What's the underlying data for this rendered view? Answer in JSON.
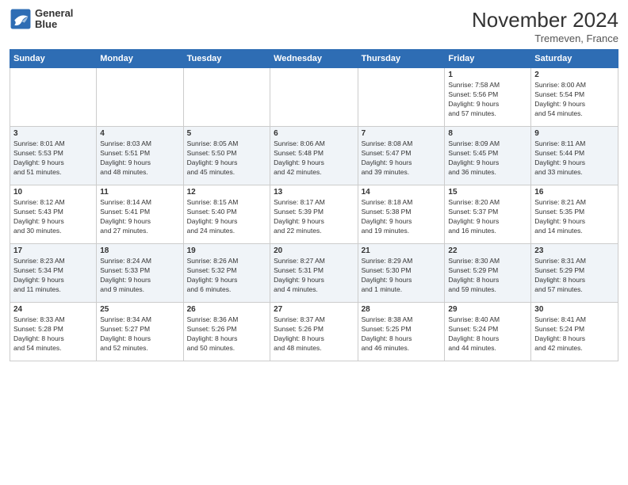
{
  "header": {
    "logo_text_line1": "General",
    "logo_text_line2": "Blue",
    "month_title": "November 2024",
    "location": "Tremeven, France"
  },
  "weekdays": [
    "Sunday",
    "Monday",
    "Tuesday",
    "Wednesday",
    "Thursday",
    "Friday",
    "Saturday"
  ],
  "weeks": [
    {
      "days": [
        {
          "num": "",
          "info": ""
        },
        {
          "num": "",
          "info": ""
        },
        {
          "num": "",
          "info": ""
        },
        {
          "num": "",
          "info": ""
        },
        {
          "num": "",
          "info": ""
        },
        {
          "num": "1",
          "info": "Sunrise: 7:58 AM\nSunset: 5:56 PM\nDaylight: 9 hours\nand 57 minutes."
        },
        {
          "num": "2",
          "info": "Sunrise: 8:00 AM\nSunset: 5:54 PM\nDaylight: 9 hours\nand 54 minutes."
        }
      ]
    },
    {
      "days": [
        {
          "num": "3",
          "info": "Sunrise: 8:01 AM\nSunset: 5:53 PM\nDaylight: 9 hours\nand 51 minutes."
        },
        {
          "num": "4",
          "info": "Sunrise: 8:03 AM\nSunset: 5:51 PM\nDaylight: 9 hours\nand 48 minutes."
        },
        {
          "num": "5",
          "info": "Sunrise: 8:05 AM\nSunset: 5:50 PM\nDaylight: 9 hours\nand 45 minutes."
        },
        {
          "num": "6",
          "info": "Sunrise: 8:06 AM\nSunset: 5:48 PM\nDaylight: 9 hours\nand 42 minutes."
        },
        {
          "num": "7",
          "info": "Sunrise: 8:08 AM\nSunset: 5:47 PM\nDaylight: 9 hours\nand 39 minutes."
        },
        {
          "num": "8",
          "info": "Sunrise: 8:09 AM\nSunset: 5:45 PM\nDaylight: 9 hours\nand 36 minutes."
        },
        {
          "num": "9",
          "info": "Sunrise: 8:11 AM\nSunset: 5:44 PM\nDaylight: 9 hours\nand 33 minutes."
        }
      ]
    },
    {
      "days": [
        {
          "num": "10",
          "info": "Sunrise: 8:12 AM\nSunset: 5:43 PM\nDaylight: 9 hours\nand 30 minutes."
        },
        {
          "num": "11",
          "info": "Sunrise: 8:14 AM\nSunset: 5:41 PM\nDaylight: 9 hours\nand 27 minutes."
        },
        {
          "num": "12",
          "info": "Sunrise: 8:15 AM\nSunset: 5:40 PM\nDaylight: 9 hours\nand 24 minutes."
        },
        {
          "num": "13",
          "info": "Sunrise: 8:17 AM\nSunset: 5:39 PM\nDaylight: 9 hours\nand 22 minutes."
        },
        {
          "num": "14",
          "info": "Sunrise: 8:18 AM\nSunset: 5:38 PM\nDaylight: 9 hours\nand 19 minutes."
        },
        {
          "num": "15",
          "info": "Sunrise: 8:20 AM\nSunset: 5:37 PM\nDaylight: 9 hours\nand 16 minutes."
        },
        {
          "num": "16",
          "info": "Sunrise: 8:21 AM\nSunset: 5:35 PM\nDaylight: 9 hours\nand 14 minutes."
        }
      ]
    },
    {
      "days": [
        {
          "num": "17",
          "info": "Sunrise: 8:23 AM\nSunset: 5:34 PM\nDaylight: 9 hours\nand 11 minutes."
        },
        {
          "num": "18",
          "info": "Sunrise: 8:24 AM\nSunset: 5:33 PM\nDaylight: 9 hours\nand 9 minutes."
        },
        {
          "num": "19",
          "info": "Sunrise: 8:26 AM\nSunset: 5:32 PM\nDaylight: 9 hours\nand 6 minutes."
        },
        {
          "num": "20",
          "info": "Sunrise: 8:27 AM\nSunset: 5:31 PM\nDaylight: 9 hours\nand 4 minutes."
        },
        {
          "num": "21",
          "info": "Sunrise: 8:29 AM\nSunset: 5:30 PM\nDaylight: 9 hours\nand 1 minute."
        },
        {
          "num": "22",
          "info": "Sunrise: 8:30 AM\nSunset: 5:29 PM\nDaylight: 8 hours\nand 59 minutes."
        },
        {
          "num": "23",
          "info": "Sunrise: 8:31 AM\nSunset: 5:29 PM\nDaylight: 8 hours\nand 57 minutes."
        }
      ]
    },
    {
      "days": [
        {
          "num": "24",
          "info": "Sunrise: 8:33 AM\nSunset: 5:28 PM\nDaylight: 8 hours\nand 54 minutes."
        },
        {
          "num": "25",
          "info": "Sunrise: 8:34 AM\nSunset: 5:27 PM\nDaylight: 8 hours\nand 52 minutes."
        },
        {
          "num": "26",
          "info": "Sunrise: 8:36 AM\nSunset: 5:26 PM\nDaylight: 8 hours\nand 50 minutes."
        },
        {
          "num": "27",
          "info": "Sunrise: 8:37 AM\nSunset: 5:26 PM\nDaylight: 8 hours\nand 48 minutes."
        },
        {
          "num": "28",
          "info": "Sunrise: 8:38 AM\nSunset: 5:25 PM\nDaylight: 8 hours\nand 46 minutes."
        },
        {
          "num": "29",
          "info": "Sunrise: 8:40 AM\nSunset: 5:24 PM\nDaylight: 8 hours\nand 44 minutes."
        },
        {
          "num": "30",
          "info": "Sunrise: 8:41 AM\nSunset: 5:24 PM\nDaylight: 8 hours\nand 42 minutes."
        }
      ]
    }
  ]
}
